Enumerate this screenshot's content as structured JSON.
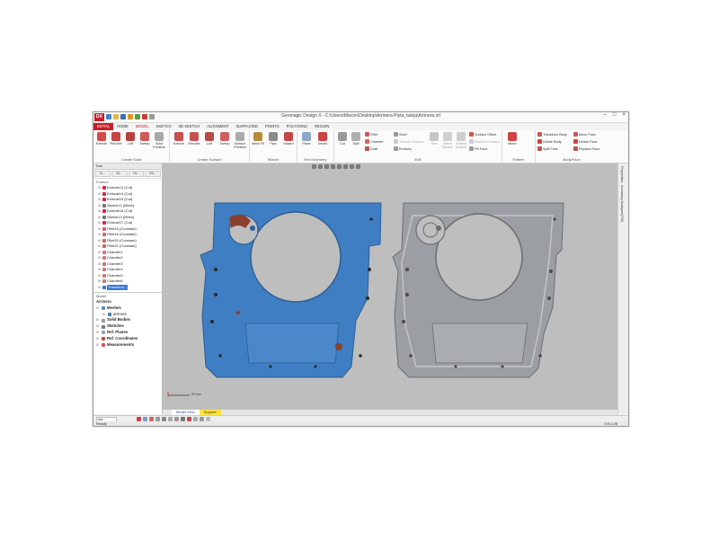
{
  "window": {
    "title": "Geomagic Design X - C:\\Users\\Marcin\\Desktop\\Arrinera Plyta_tuleja\\Arrinera.xrl",
    "minimize": "–",
    "maximize": "□",
    "close": "×",
    "logo_text": "DX"
  },
  "menu_tabs": {
    "file": "INITIAL",
    "items": [
      "HOME",
      "MODEL",
      "SKETCH",
      "3D SKETCH",
      "ALIGNMENT",
      "SURFACING",
      "POINTS",
      "POLYGONS",
      "REGION"
    ]
  },
  "ribbon": {
    "groups": {
      "create_solid": {
        "name": "Create Solid",
        "buttons": [
          "Extrude",
          "Revolve",
          "Loft",
          "Sweep",
          "Solid Primitive"
        ]
      },
      "create_surface": {
        "name": "Create Surface",
        "buttons": [
          "Extrude",
          "Revolve",
          "Loft",
          "Sweep",
          "Surface Primitive"
        ]
      },
      "wizard": {
        "name": "Wizard",
        "buttons": [
          "Mesh Fit",
          "Pipe",
          "Wizard"
        ]
      },
      "ref_geometry": {
        "name": "Ref.Geometry",
        "buttons": [
          "Plane",
          "Vector"
        ]
      },
      "edit": {
        "name": "Edit",
        "big_buttons": [
          "Cut",
          "Split"
        ],
        "small": [
          "Fillet",
          "Chamfer",
          "Draft",
          "Shell",
          "Thicken Surface",
          "Emboss",
          "Trim",
          "Untrim Surface",
          "Extend Surface",
          "Surface Offset",
          "Remove Surface",
          "Fill Face"
        ]
      },
      "pattern": {
        "name": "Pattern",
        "buttons": [
          "Mirror"
        ]
      },
      "body_face": {
        "name": "Body/Face",
        "small": [
          "Transform Body",
          "Delete Body",
          "Split Face",
          "Move Face",
          "Delete Face",
          "Replace Face"
        ]
      }
    }
  },
  "left_panel": {
    "header": "Tree",
    "tabs": [
      "Tr...",
      "Di...",
      "Hi...",
      "VC..."
    ],
    "feature_label": "Feature",
    "features": [
      "Extrude13 (Cut)",
      "Extrude14 (Cut)",
      "Extrude15 (Cut)",
      "Sketch12 (Mesh)",
      "Extrude16 (Cut)",
      "Sketch13 (Mesh)",
      "Extrude17 (Cut)",
      "Fillet15 (Constant)",
      "Fillet16 (Constant)",
      "Fillet20 (Constant)",
      "Fillet21 (Constant)",
      "Chamfer1",
      "Chamfer2",
      "Chamfer3",
      "Chamfer4",
      "Chamfer5",
      "Chamfer6",
      "Transform..."
    ],
    "model_label": "Model",
    "model_root": "Arrinera",
    "model_items": [
      "Meshes",
      "arrinera",
      "Solid Bodies",
      "Sketches",
      "Ref. Planes",
      "Ref. Coordinates",
      "Measurements"
    ]
  },
  "viewport": {
    "scale_label": "50 mm",
    "background": "#bebebe",
    "part_colors": {
      "scanned": "#3f7ec2",
      "cad": "#9b9ea3",
      "deviation": "#8b3f2e"
    }
  },
  "right_strip": {
    "tabs": [
      "Properties",
      "Accuracy Analyzer(TM)"
    ]
  },
  "view_tabs": [
    "Model View",
    "Support"
  ],
  "bottom_bar": {
    "select_value": "Aut..."
  },
  "status": {
    "left": "Ready",
    "right": "0:0:1:28"
  },
  "colors": {
    "accent": "#c8202b",
    "selection": "#3a79d8"
  }
}
